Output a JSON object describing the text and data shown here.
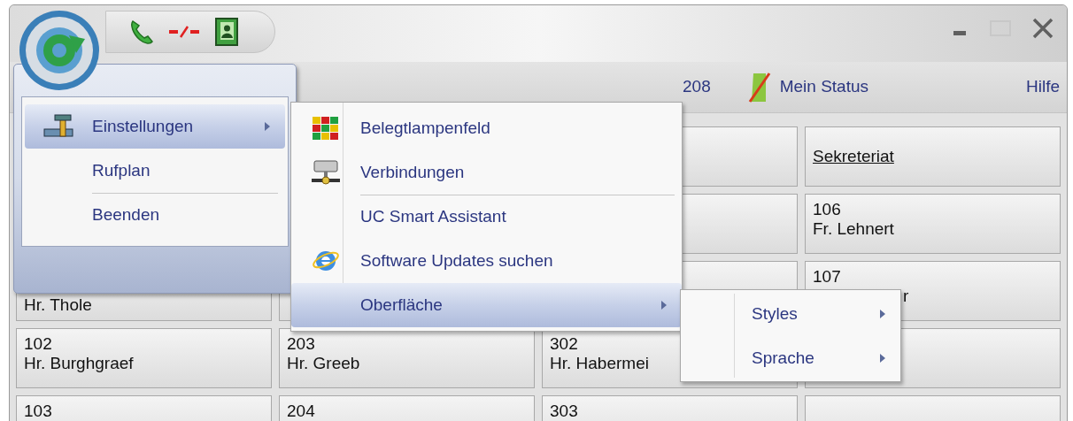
{
  "toolbar": {
    "extension": "208",
    "status": "Mein Status",
    "help": "Hilfe"
  },
  "grid": {
    "rows": [
      [
        {
          "kind": "empty"
        },
        {
          "kind": "empty"
        },
        {
          "kind": "empty"
        },
        {
          "kind": "heading",
          "lines": [
            "Sekreteriat"
          ]
        }
      ],
      [
        {
          "kind": "empty"
        },
        {
          "kind": "empty"
        },
        {
          "kind": "empty"
        },
        {
          "kind": "contact",
          "lines": [
            "106",
            "Fr. Lehnert"
          ]
        }
      ],
      [
        {
          "kind": "covered_top",
          "lines": [
            "Hr. Thole"
          ]
        },
        {
          "kind": "empty"
        },
        {
          "kind": "empty"
        },
        {
          "kind": "covered_right",
          "lines": [
            "107",
            "r"
          ]
        }
      ],
      [
        {
          "kind": "contact",
          "lines": [
            "102",
            "Hr. Burghgraef"
          ]
        },
        {
          "kind": "contact",
          "lines": [
            "203",
            "Hr. Greeb"
          ]
        },
        {
          "kind": "contact",
          "lines": [
            "302",
            "Hr. Habermei"
          ]
        },
        {
          "kind": "empty"
        }
      ],
      [
        {
          "kind": "contact",
          "lines": [
            "103"
          ]
        },
        {
          "kind": "contact",
          "lines": [
            "204"
          ]
        },
        {
          "kind": "contact",
          "lines": [
            "303"
          ]
        },
        {
          "kind": "empty"
        }
      ]
    ]
  },
  "app_menu": {
    "items": [
      {
        "label": "Einstellungen",
        "selected": true,
        "has_submenu": true,
        "separator_before": false
      },
      {
        "label": "Rufplan",
        "selected": false,
        "has_submenu": false,
        "separator_before": false
      },
      {
        "label": "Beenden",
        "selected": false,
        "has_submenu": false,
        "separator_before": true
      }
    ]
  },
  "settings_submenu": {
    "items": [
      {
        "label": "Belegtlampenfeld",
        "selected": false,
        "has_submenu": false,
        "separator_before": false
      },
      {
        "label": "Verbindungen",
        "selected": false,
        "has_submenu": false,
        "separator_before": false
      },
      {
        "label": "UC Smart Assistant",
        "selected": false,
        "has_submenu": false,
        "separator_before": true
      },
      {
        "label": "Software Updates suchen",
        "selected": false,
        "has_submenu": false,
        "separator_before": false
      },
      {
        "label": "Oberfläche",
        "selected": true,
        "has_submenu": true,
        "separator_before": false
      }
    ]
  },
  "surface_submenu": {
    "items": [
      {
        "label": "Styles",
        "selected": false,
        "has_submenu": true,
        "separator_before": false
      },
      {
        "label": "Sprache",
        "selected": false,
        "has_submenu": true,
        "separator_before": false
      }
    ]
  }
}
